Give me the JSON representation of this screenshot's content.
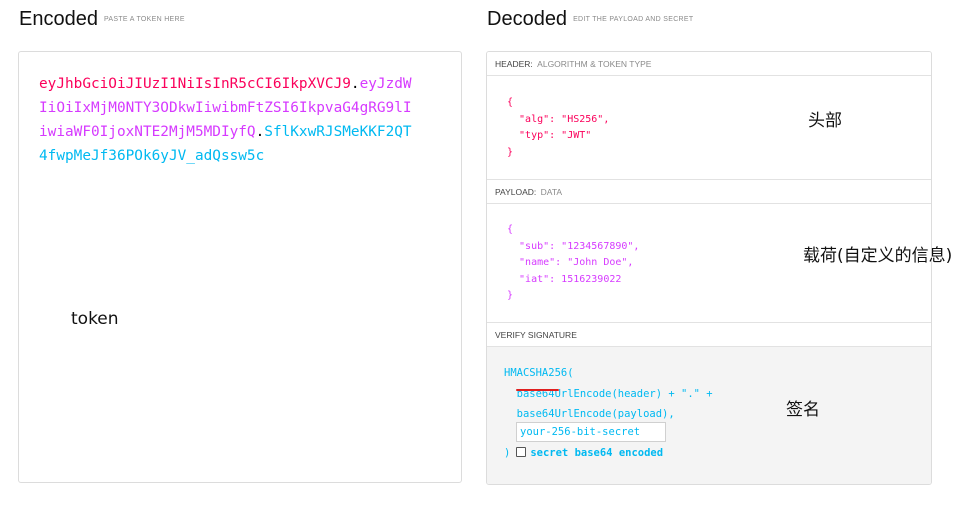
{
  "encoded": {
    "title": "Encoded",
    "subtitle": "PASTE A TOKEN HERE",
    "token_header": "eyJhbGciOiJIUzI1NiIsInR5cCI6IkpXVCJ9",
    "token_payload": "eyJzdWIiOiIxMjM0NTY3ODkwIiwibmFtZSI6IkpvaG4gRG9lIiwiaWF0IjoxNTE2MjM5MDIyfQ",
    "token_signature": "SflKxwRJSMeKKF2QT4fwpMeJf36POk6yJV_adQssw5c",
    "dot": "."
  },
  "decoded": {
    "title": "Decoded",
    "subtitle": "EDIT THE PAYLOAD AND SECRET",
    "header": {
      "label": "HEADER:",
      "sublabel": "ALGORITHM & TOKEN TYPE",
      "json": "{\n  \"alg\": \"HS256\",\n  \"typ\": \"JWT\"\n}"
    },
    "payload": {
      "label": "PAYLOAD:",
      "sublabel": "DATA",
      "json": "{\n  \"sub\": \"1234567890\",\n  \"name\": \"John Doe\",\n  \"iat\": 1516239022\n}"
    },
    "signature": {
      "label": "VERIFY SIGNATURE",
      "code": "HMACSHA256(\n  base64UrlEncode(header) + \".\" +\n  base64UrlEncode(payload),",
      "secret_placeholder": "your-256-bit-secret",
      "close": ")",
      "checkbox_label": "secret base64 encoded"
    }
  },
  "annotations": {
    "token": "token",
    "header": "头部",
    "payload": "载荷(自定义的信息)",
    "signature": "签名"
  },
  "colors": {
    "header": "#fb015b",
    "payload": "#d63aff",
    "signature": "#00b9f1"
  }
}
